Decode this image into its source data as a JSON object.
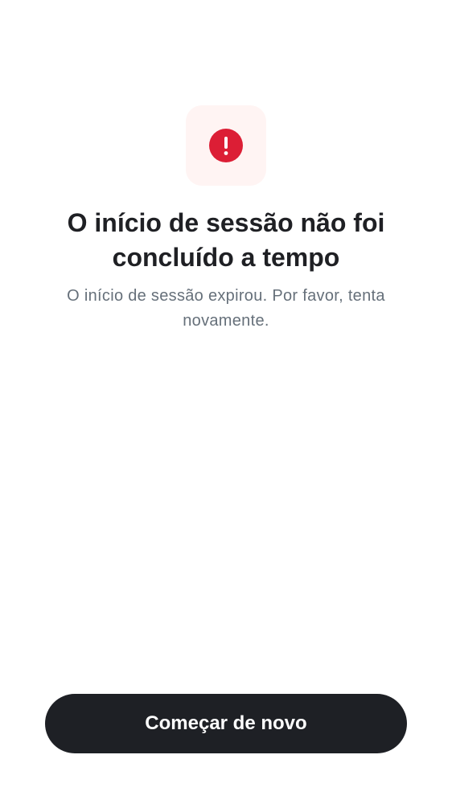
{
  "status_icon": {
    "name": "alert-icon",
    "background": "#fff4f3",
    "color": "#dc1e35"
  },
  "message": {
    "title": "O início de sessão não foi concluído a tempo",
    "description": "O início de sessão expirou. Por favor, tenta novamente."
  },
  "actions": {
    "restart_label": "Começar de novo",
    "restart_color": "#1e2025"
  }
}
